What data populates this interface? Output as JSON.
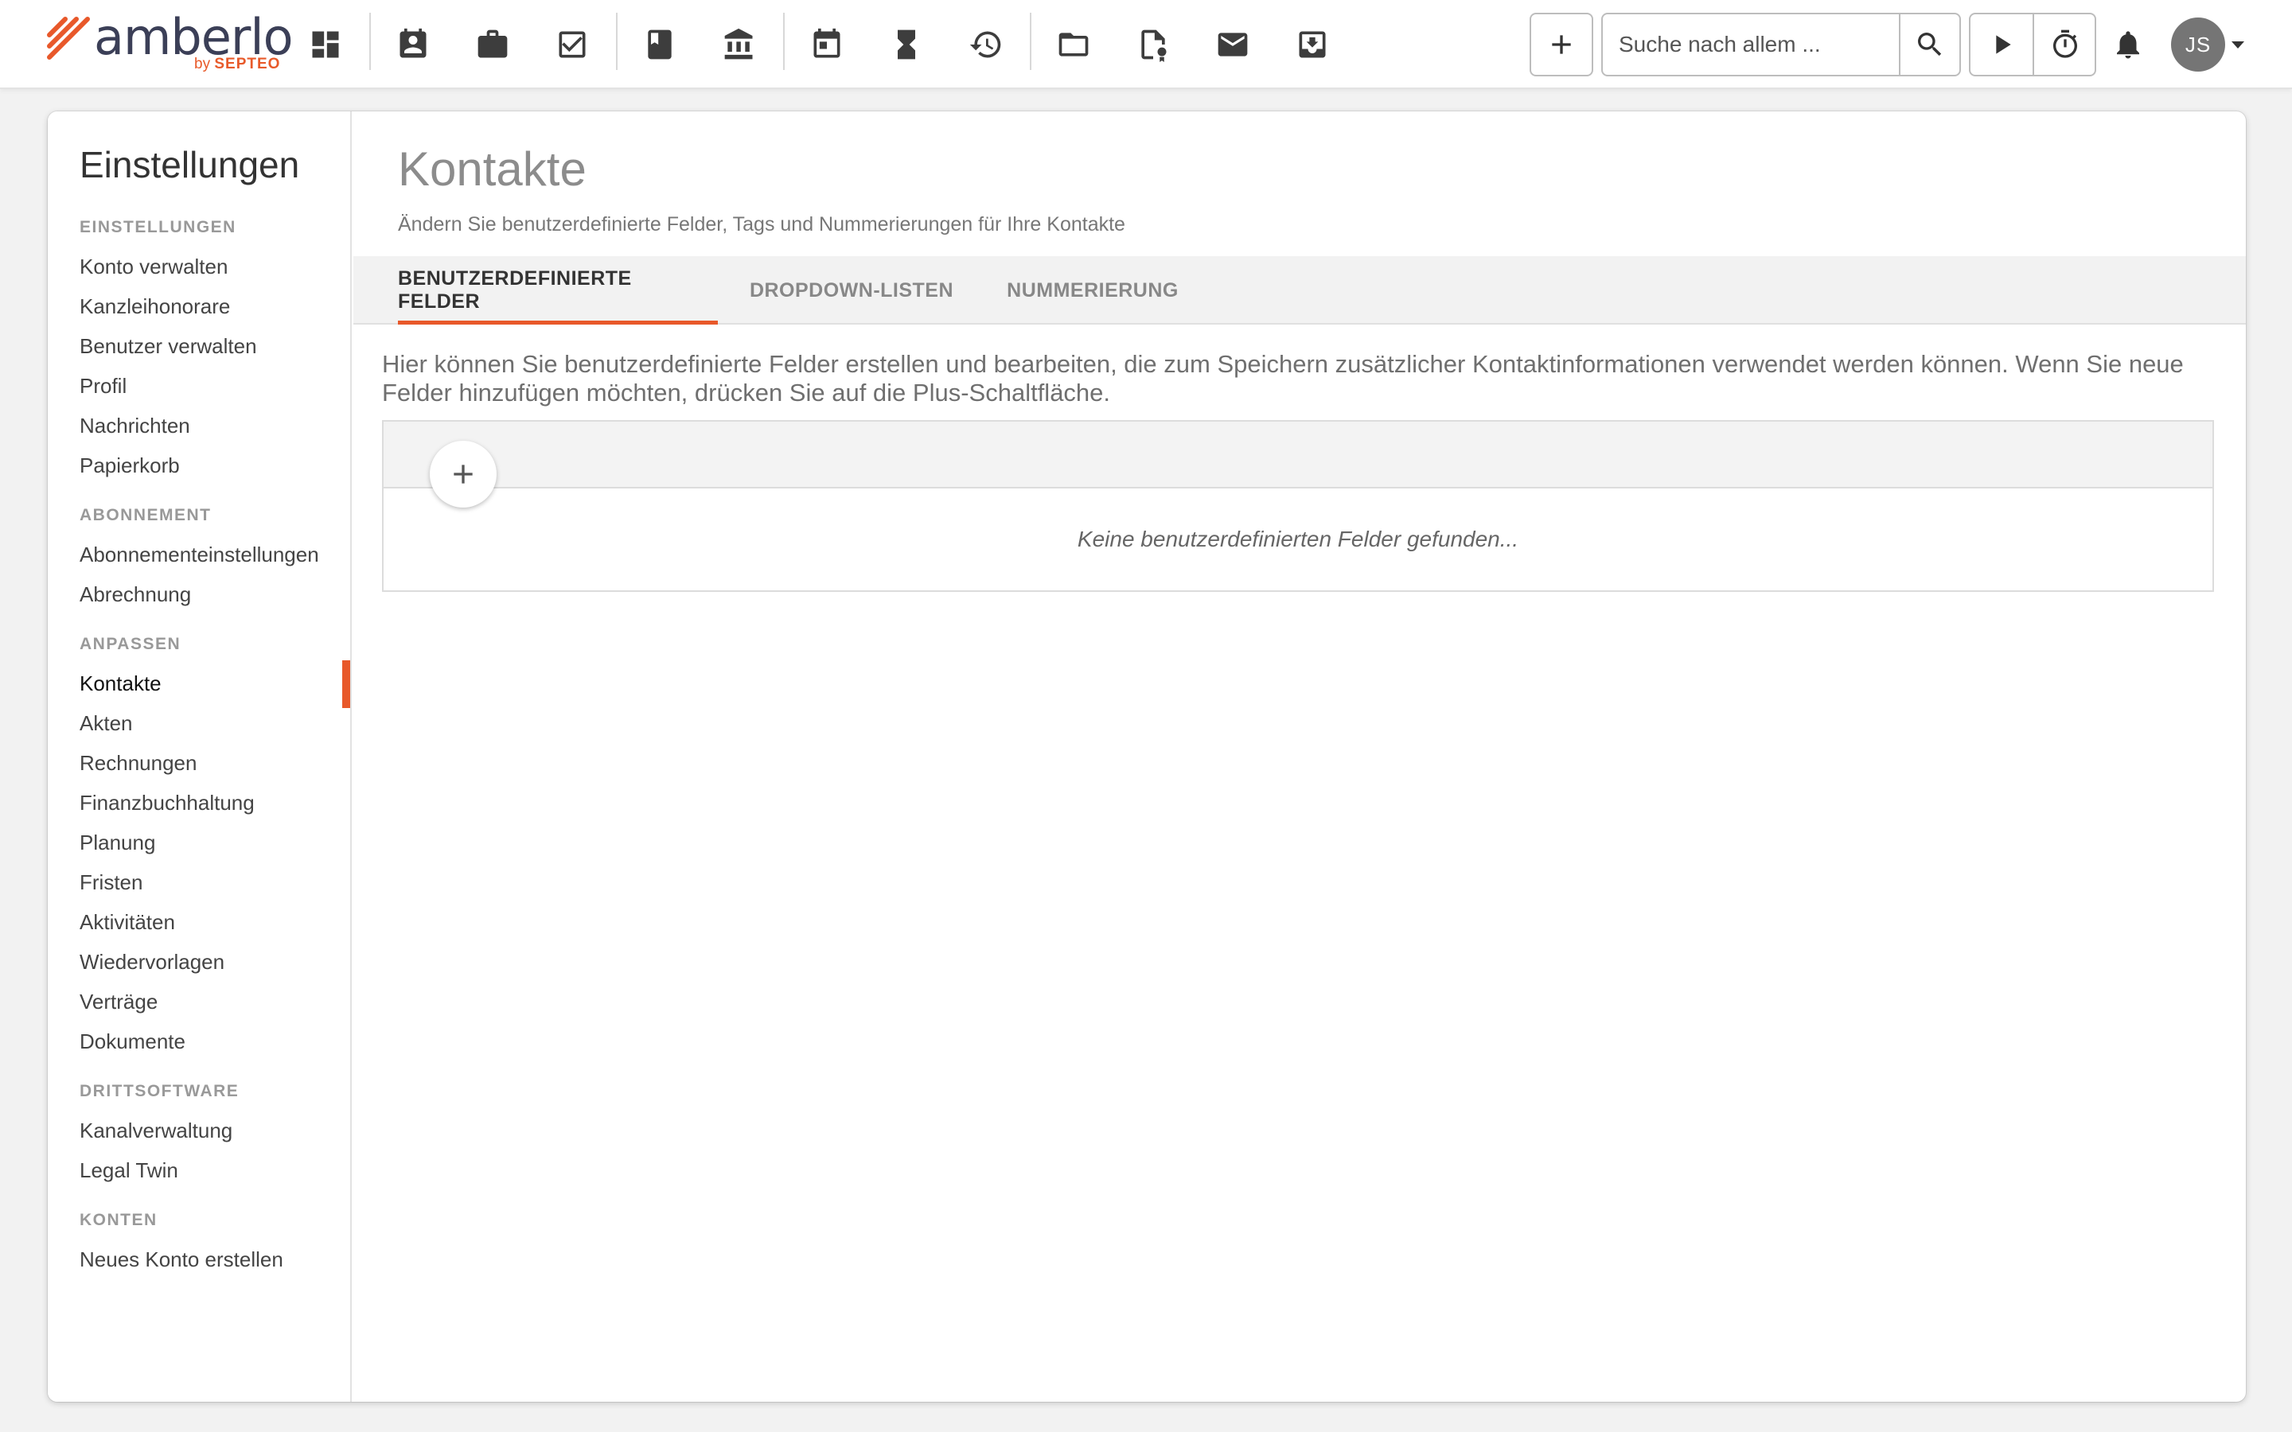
{
  "brand": {
    "name": "amberlo",
    "by": "by",
    "company": "SEPTEO",
    "accent_color": "#e8582a"
  },
  "toolbar": {
    "nav_icons": [
      "dashboard-icon",
      "contacts-icon",
      "briefcase-icon",
      "tasks-icon",
      "book-icon",
      "bank-icon",
      "calendar-icon",
      "hourglass-icon",
      "time-billing-icon",
      "folder-icon",
      "certificate-icon",
      "mail-icon",
      "inbox-icon"
    ],
    "search": {
      "placeholder": "Suche nach allem ...",
      "value": ""
    },
    "user_initials": "JS"
  },
  "sidebar": {
    "title": "Einstellungen",
    "sections": [
      {
        "label": "EINSTELLUNGEN",
        "items": [
          "Konto verwalten",
          "Kanzleihonorare",
          "Benutzer verwalten",
          "Profil",
          "Nachrichten",
          "Papierkorb"
        ]
      },
      {
        "label": "ABONNEMENT",
        "items": [
          "Abonnementeinstellungen",
          "Abrechnung"
        ]
      },
      {
        "label": "ANPASSEN",
        "items": [
          "Kontakte",
          "Akten",
          "Rechnungen",
          "Finanzbuchhaltung",
          "Planung",
          "Fristen",
          "Aktivitäten",
          "Wiedervorlagen",
          "Verträge",
          "Dokumente"
        ]
      },
      {
        "label": "DRITTSOFTWARE",
        "items": [
          "Kanalverwaltung",
          "Legal Twin"
        ]
      },
      {
        "label": "KONTEN",
        "items": [
          "Neues Konto erstellen"
        ]
      }
    ],
    "active_item": "Kontakte"
  },
  "main": {
    "title": "Kontakte",
    "subtitle": "Ändern Sie benutzerdefinierte Felder, Tags und Nummerierungen für Ihre Kontakte",
    "tabs": [
      {
        "label": "BENUTZERDEFINIERTE FELDER",
        "active": true
      },
      {
        "label": "DROPDOWN-LISTEN",
        "active": false
      },
      {
        "label": "NUMMERIERUNG",
        "active": false
      }
    ],
    "info": "Hier können Sie benutzerdefinierte Felder erstellen und bearbeiten, die zum Speichern zusätzlicher Kontaktinformationen verwendet werden können. Wenn Sie neue Felder hinzufügen möchten, drücken Sie auf die Plus-Schaltfläche.",
    "empty_message": "Keine benutzerdefinierten Felder gefunden..."
  }
}
